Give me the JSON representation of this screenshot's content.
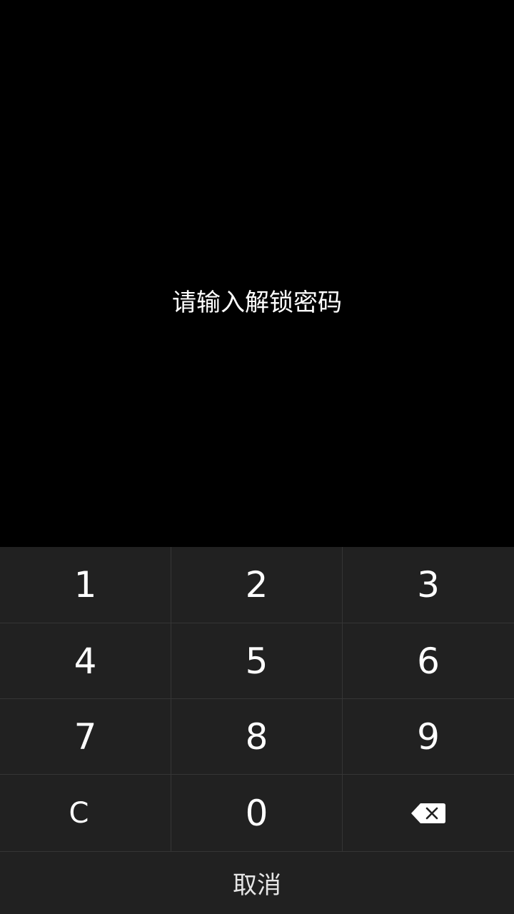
{
  "prompt": {
    "text": "请输入解锁密码"
  },
  "keypad": {
    "keys": [
      "1",
      "2",
      "3",
      "4",
      "5",
      "6",
      "7",
      "8",
      "9",
      "C",
      "0"
    ],
    "backspace_icon": "backspace-icon"
  },
  "cancel": {
    "label": "取消"
  },
  "colors": {
    "background": "#000000",
    "keypad_background": "#212121",
    "divider": "#353535",
    "text": "#ffffff"
  }
}
